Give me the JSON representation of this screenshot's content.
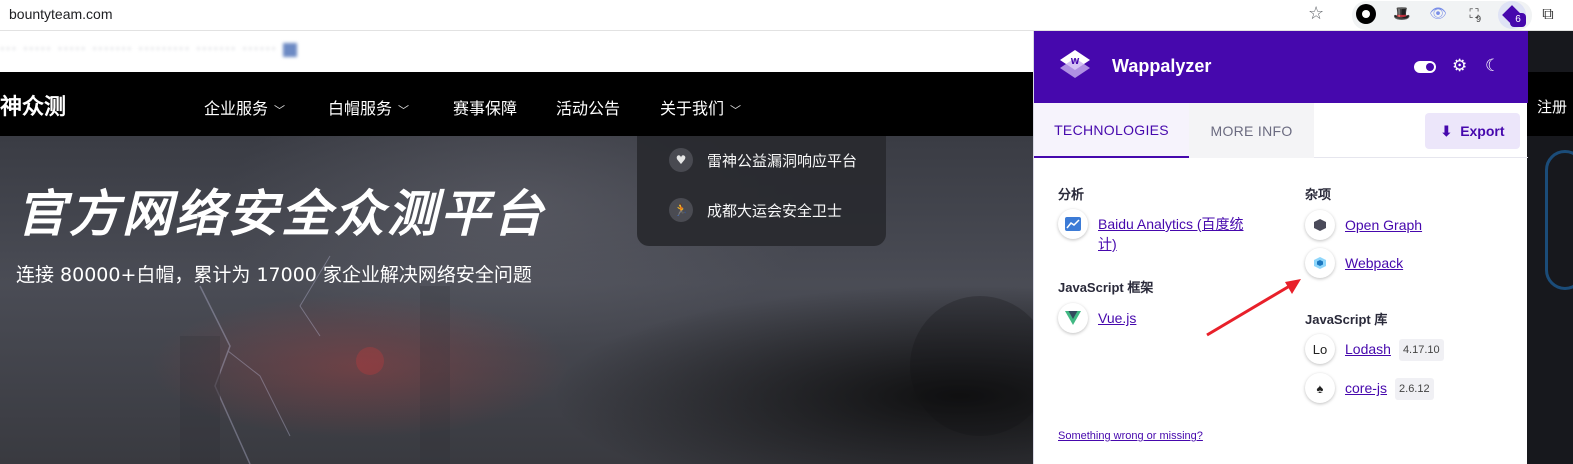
{
  "browser": {
    "url": "bountyteam.com",
    "extension_badges": {
      "unread": "9",
      "wappalyzer": "6"
    }
  },
  "site": {
    "topbar_blurred": "··· ····· ····· ······· ·········  ·······  ······",
    "logo": "神众测",
    "nav": [
      {
        "label": "企业服务",
        "has_dropdown": true
      },
      {
        "label": "白帽服务",
        "has_dropdown": true
      },
      {
        "label": "赛事保障",
        "has_dropdown": false
      },
      {
        "label": "活动公告",
        "has_dropdown": false
      },
      {
        "label": "关于我们",
        "has_dropdown": true
      }
    ],
    "dropdown": [
      {
        "icon": "heart-broken-icon",
        "label": "雷神公益漏洞响应平台"
      },
      {
        "icon": "runner-icon",
        "label": "成都大运会安全卫士"
      }
    ],
    "hero_title": "官方网络安全众测平台",
    "hero_subtitle": "连接 80000+白帽，累计为 17000 家企业解决网络安全问题",
    "register": "注册"
  },
  "wappalyzer": {
    "brand": "Wappalyzer",
    "accent": "#4608ad",
    "tabs": [
      {
        "label": "TECHNOLOGIES",
        "active": true
      },
      {
        "label": "MORE INFO",
        "active": false
      }
    ],
    "export_label": "Export",
    "left_column": [
      {
        "category": "分析",
        "items": [
          {
            "name": "Baidu Analytics (百度统计)",
            "version": ""
          }
        ]
      },
      {
        "category": "JavaScript 框架",
        "items": [
          {
            "name": "Vue.js",
            "version": ""
          }
        ]
      }
    ],
    "right_column": [
      {
        "category": "杂项",
        "items": [
          {
            "name": "Open Graph",
            "version": ""
          },
          {
            "name": "Webpack",
            "version": ""
          }
        ]
      },
      {
        "category": "JavaScript 库",
        "items": [
          {
            "name": "Lodash",
            "version": "4.17.10"
          },
          {
            "name": "core-js",
            "version": "2.6.12"
          }
        ]
      }
    ],
    "footer_link": "Something wrong or missing?"
  }
}
